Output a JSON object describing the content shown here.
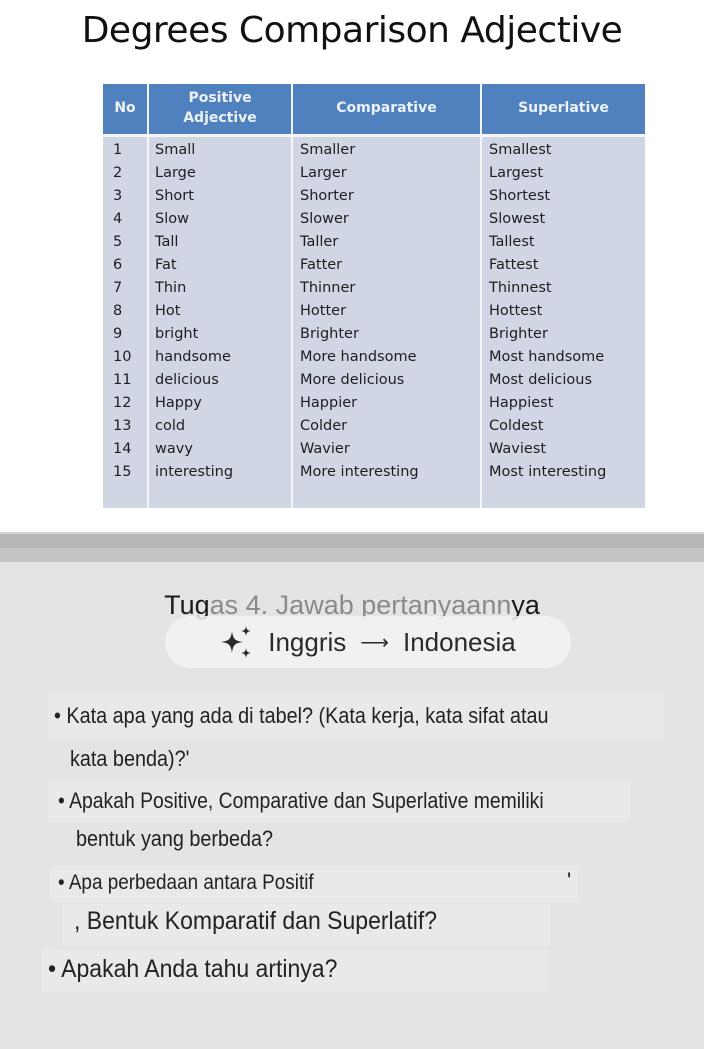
{
  "document": {
    "title": "Degrees Comparison Adjective",
    "table": {
      "headers": [
        "No",
        "Positive Adjective",
        "Comparative",
        "Superlative"
      ],
      "rows": [
        [
          "1",
          "Small",
          "Smaller",
          "Smallest"
        ],
        [
          "2",
          "Large",
          "Larger",
          "Largest"
        ],
        [
          "3",
          "Short",
          "Shorter",
          "Shortest"
        ],
        [
          "4",
          "Slow",
          "Slower",
          "Slowest"
        ],
        [
          "5",
          "Tall",
          "Taller",
          "Tallest"
        ],
        [
          "6",
          "Fat",
          "Fatter",
          "Fattest"
        ],
        [
          "7",
          "Thin",
          "Thinner",
          "Thinnest"
        ],
        [
          "8",
          "Hot",
          "Hotter",
          "Hottest"
        ],
        [
          "9",
          "bright",
          "Brighter",
          "Brighter"
        ],
        [
          "10",
          "handsome",
          "More handsome",
          "Most handsome"
        ],
        [
          "11",
          "delicious",
          "More delicious",
          "Most delicious"
        ],
        [
          "12",
          "Happy",
          "Happier",
          "Happiest"
        ],
        [
          "13",
          "cold",
          "Colder",
          "Coldest"
        ],
        [
          "14",
          "wavy",
          "Wavier",
          "Waviest"
        ],
        [
          "15",
          "interesting",
          "More interesting",
          "Most interesting"
        ]
      ],
      "colors": {
        "header": "#4e81be",
        "body": "#d1d6e4"
      }
    }
  },
  "task": {
    "title_part1": "Tug",
    "title_part2": "as 4. Jawab pertanyaann",
    "title_part3": "ya",
    "translate": {
      "icon": "sparkle-icon",
      "from": "Inggris",
      "arrow": "⟶",
      "to": "Indonesia"
    },
    "questions": [
      {
        "line1": "• Kata apa yang ada di tabel? (Kata kerja, kata sifat atau",
        "line2": "kata benda)?'"
      },
      {
        "line1": "• Apakah Positive, Comparative dan Superlative memiliki",
        "line2": "bentuk yang berbeda?"
      },
      {
        "line1": "• Apa perbedaan antara Positif",
        "line1_tail": "'",
        "line2": ", Bentuk Komparatif dan Superlatif?"
      },
      {
        "line1": "• Apakah Anda tahu artinya?"
      }
    ]
  }
}
